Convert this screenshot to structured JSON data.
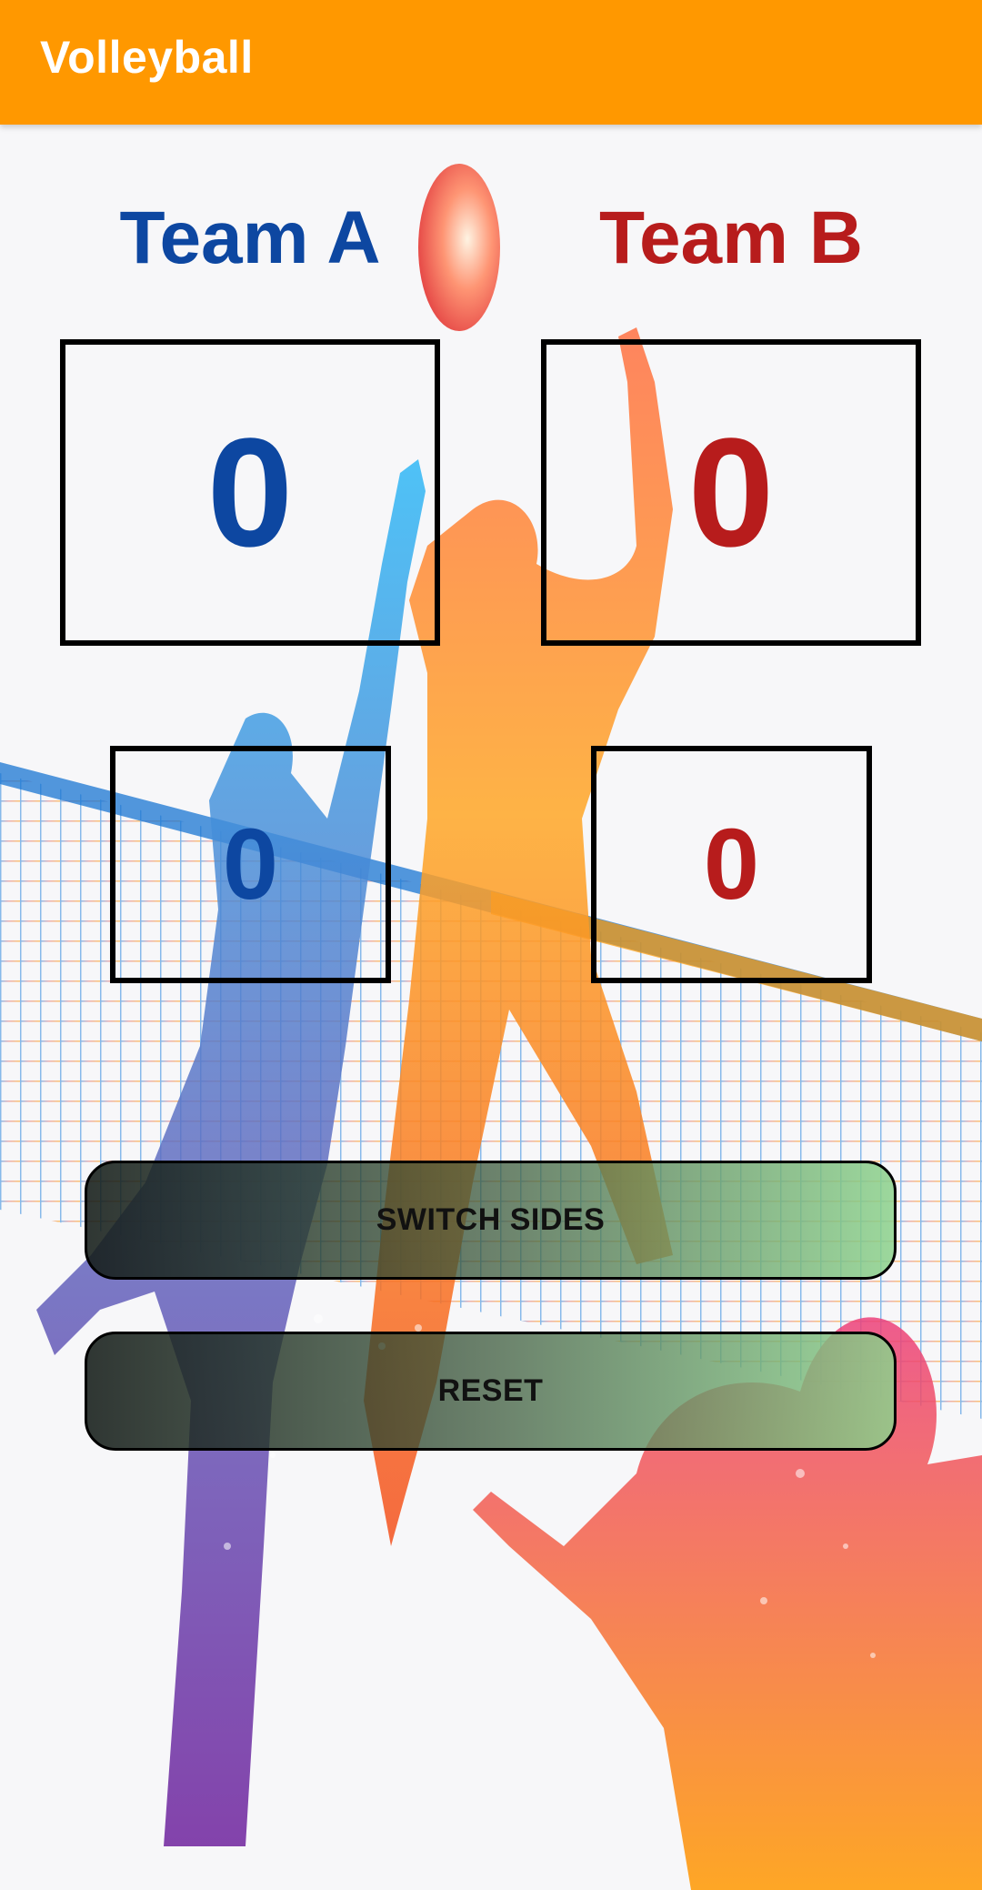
{
  "app": {
    "title": "Volleyball"
  },
  "teams": {
    "a": {
      "name": "Team A",
      "score": "0",
      "sets": "0",
      "color": "#0d47a1"
    },
    "b": {
      "name": "Team B",
      "score": "0",
      "sets": "0",
      "color": "#b71c1c"
    }
  },
  "buttons": {
    "switch_sides": "SWITCH SIDES",
    "reset": "RESET"
  },
  "theme": {
    "accent": "#ff9800"
  },
  "background": {
    "icon": "volleyball-players-illustration"
  }
}
